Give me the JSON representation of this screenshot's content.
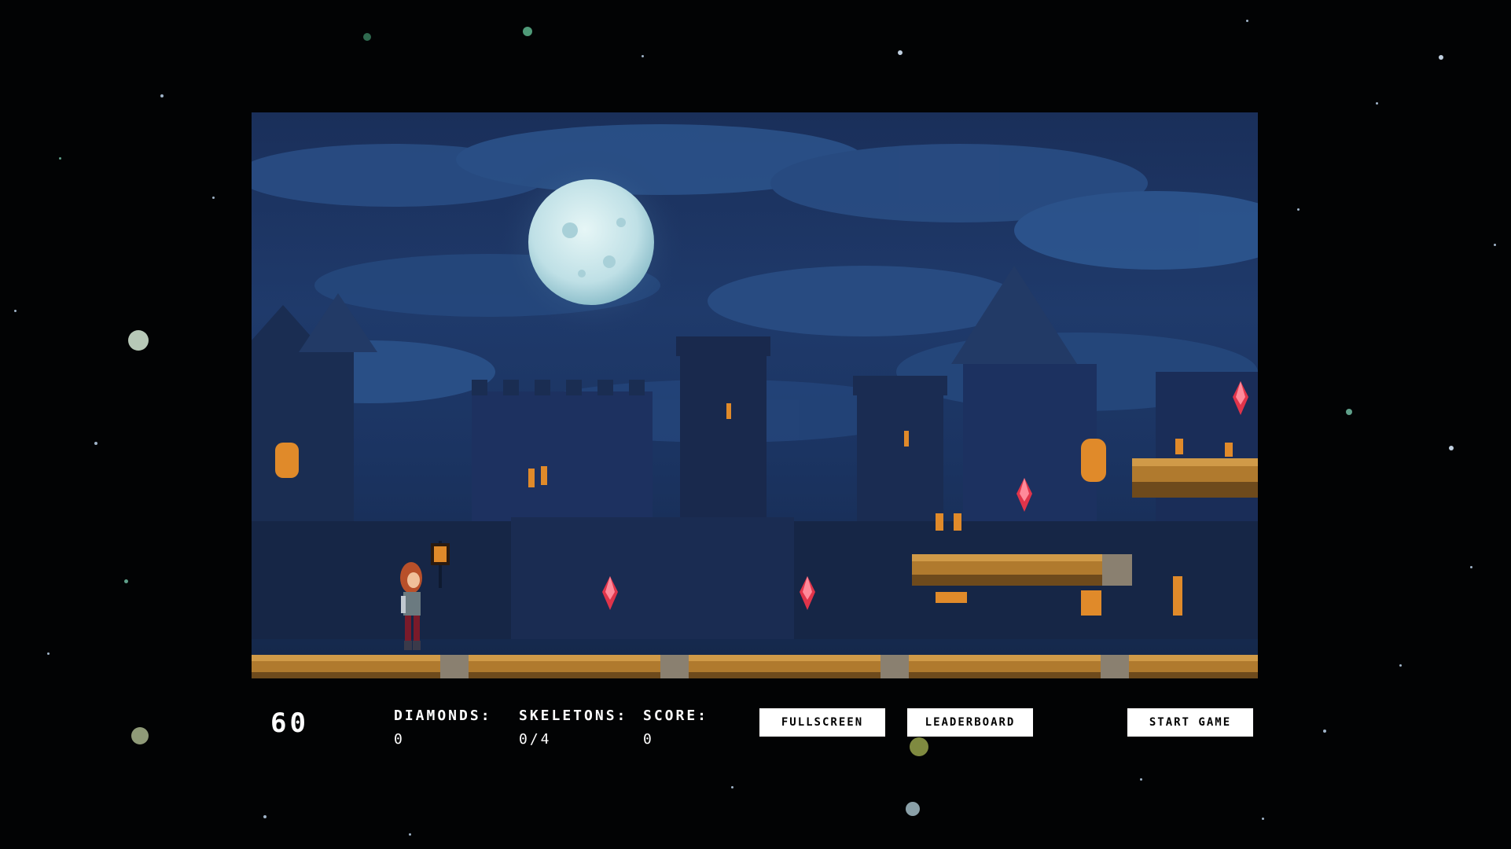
{
  "hud": {
    "fps": "60",
    "diamonds_label": "DIAMONDS:",
    "diamonds_value": "0",
    "skeletons_label": "SKELETONS:",
    "skeletons_value": "0/4",
    "score_label": "SCORE:",
    "score_value": "0"
  },
  "buttons": {
    "fullscreen": "FULLSCREEN",
    "leaderboard": "LEADERBOARD",
    "start_game": "START GAME"
  },
  "colors": {
    "background": "#020304",
    "sky": "#1f3a6b",
    "moon": "#cfe8ee",
    "ground": "#b07a2e",
    "diamond": "#e0344a",
    "window_light": "#e08a2a"
  },
  "icons": [
    "moon-icon",
    "diamond-icon",
    "player-character",
    "lantern-icon"
  ]
}
